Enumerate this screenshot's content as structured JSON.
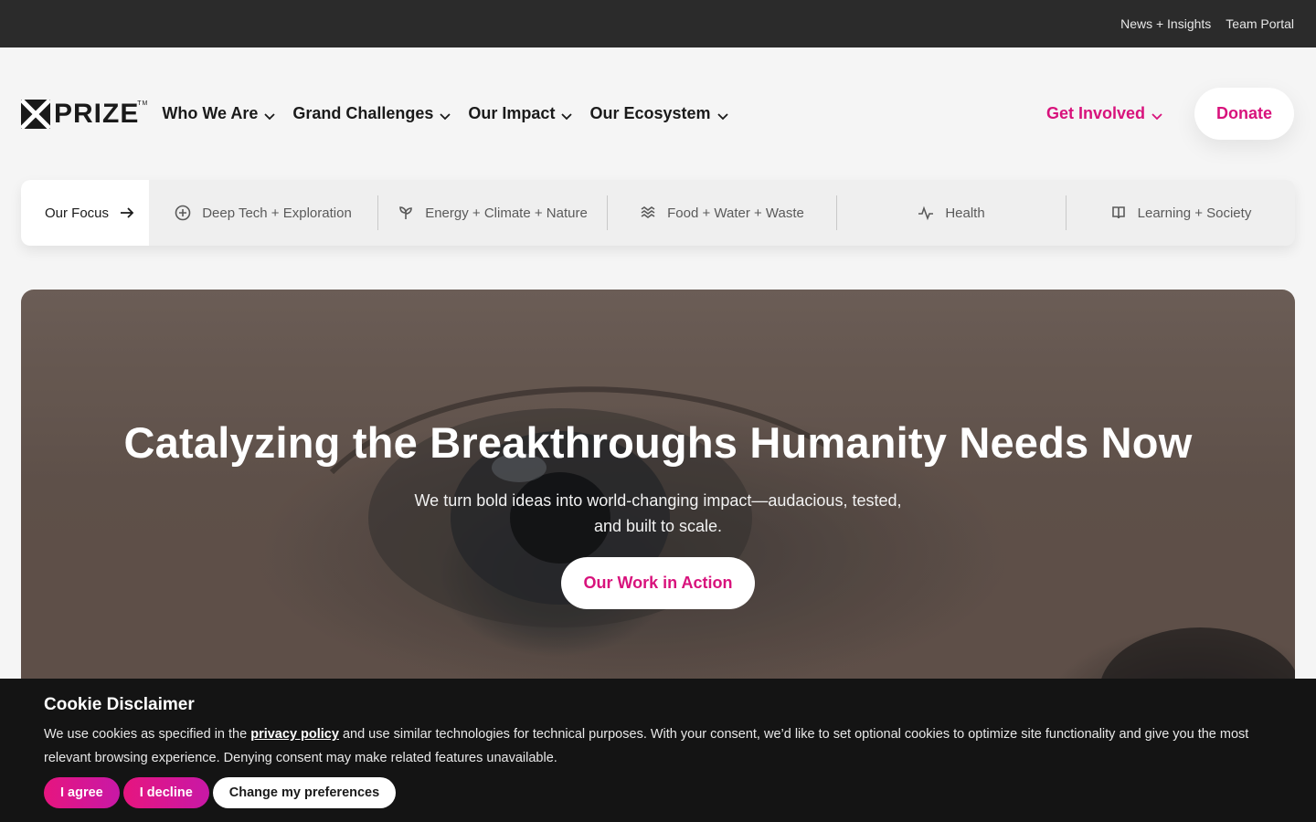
{
  "topbar": {
    "links": [
      "News + Insights",
      "Team Portal"
    ]
  },
  "logo": {
    "text": "PRIZE",
    "tm": "TM"
  },
  "nav": {
    "items": [
      "Who We Are",
      "Grand Challenges",
      "Our Impact",
      "Our Ecosystem"
    ],
    "get_involved": "Get Involved",
    "donate": "Donate"
  },
  "focus": {
    "label": "Our Focus",
    "items": [
      {
        "label": "Deep Tech + Exploration",
        "icon": "compass-icon"
      },
      {
        "label": "Energy + Climate + Nature",
        "icon": "sprout-icon"
      },
      {
        "label": "Food + Water + Waste",
        "icon": "waves-icon"
      },
      {
        "label": "Health",
        "icon": "pulse-icon"
      },
      {
        "label": "Learning + Society",
        "icon": "book-icon"
      }
    ]
  },
  "hero": {
    "title": "Catalyzing the Breakthroughs Humanity Needs Now",
    "subtitle": "We turn bold ideas into world-changing impact—audacious, tested, and built to scale.",
    "cta": "Our Work in Action"
  },
  "cookie": {
    "title": "Cookie Disclaimer",
    "text_before": "We use cookies as specified in the ",
    "link": "privacy policy",
    "text_after": " and use similar technologies for technical purposes. With your consent, we’d like to set optional cookies to optimize site functionality and give you the most relevant browsing experience. Denying consent may make related features unavailable.",
    "agree": "I agree",
    "decline": "I decline",
    "preferences": "Change my preferences"
  },
  "colors": {
    "accent": "#d8127c",
    "topbar": "#2b2b2b",
    "cookie_bg": "#141414"
  }
}
